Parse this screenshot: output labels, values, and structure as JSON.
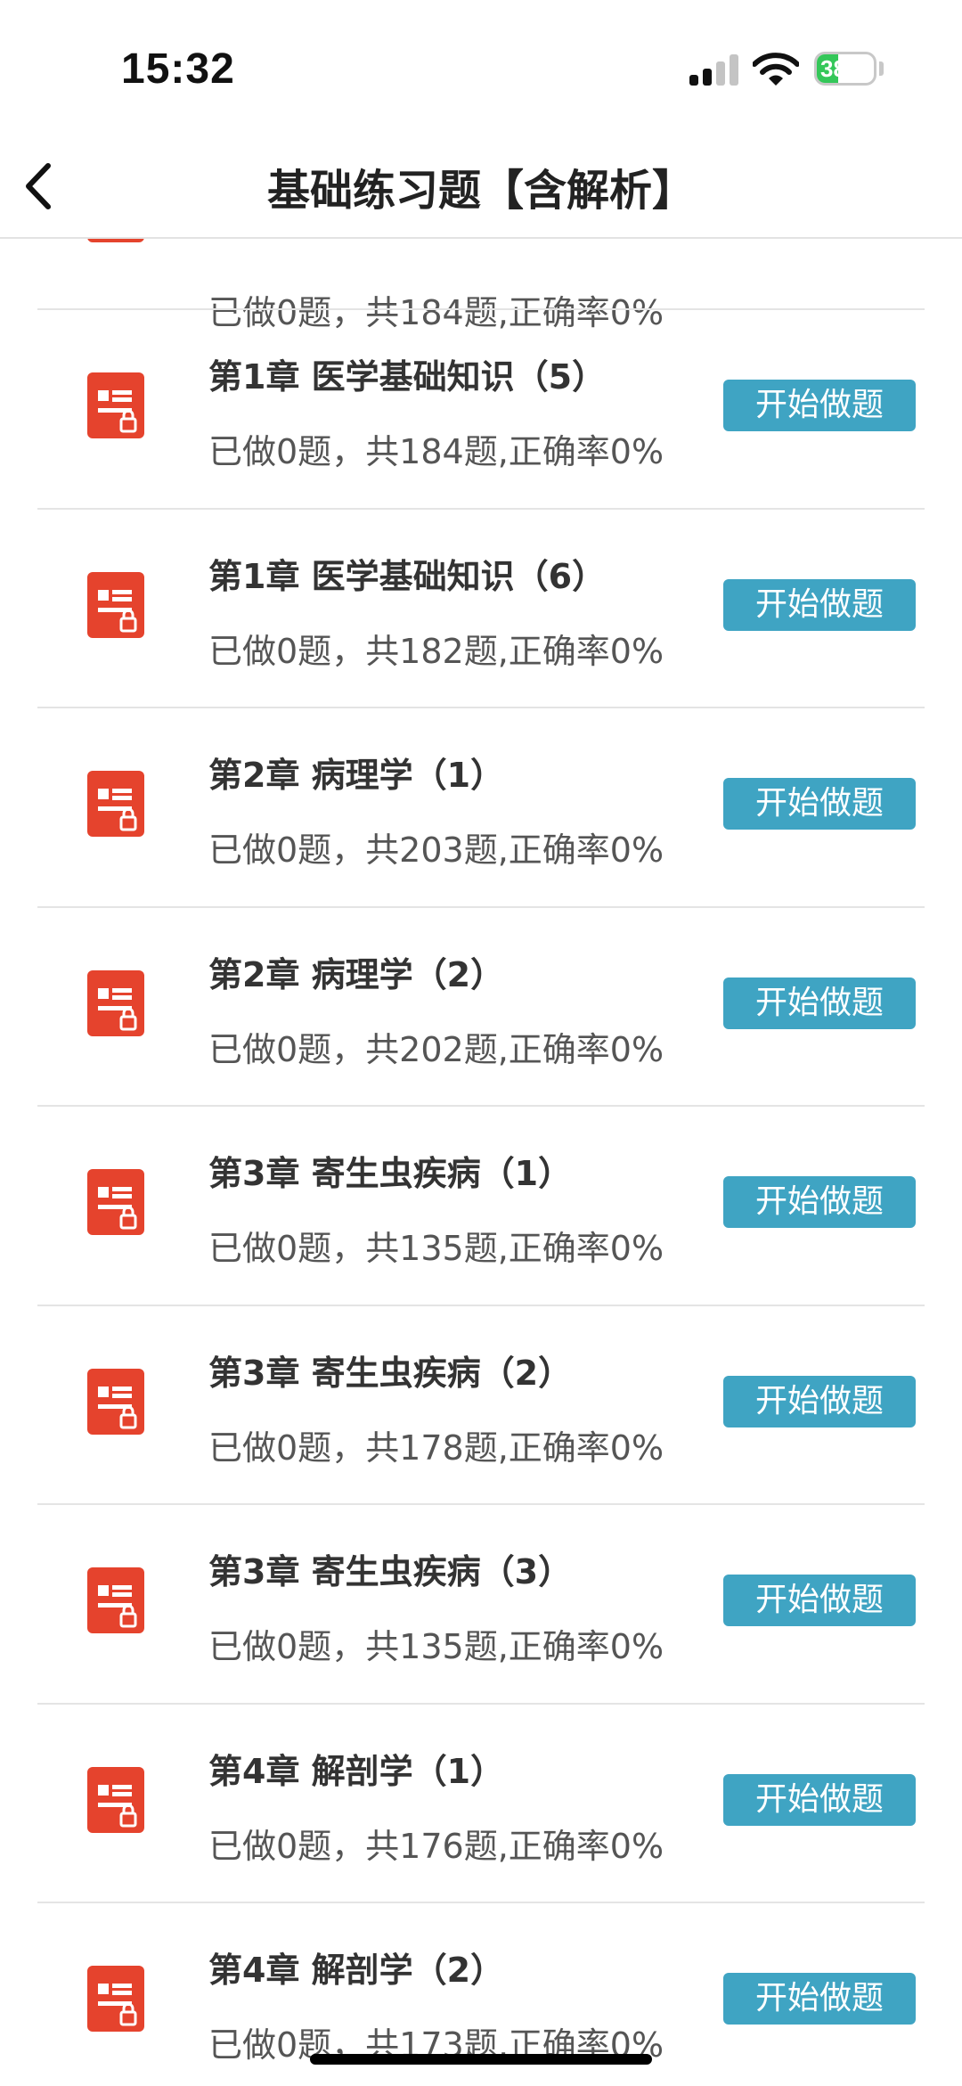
{
  "status_bar": {
    "time": "15:32",
    "battery": "38",
    "battery_level": 0.38,
    "battery_color": "#34c759"
  },
  "nav": {
    "title": "基础练习题【含解析】",
    "back_icon": "chevron-left-icon"
  },
  "colors": {
    "icon_red": "#e5432d",
    "button_blue": "#3fa4c3"
  },
  "partial_item": {
    "subtitle": "已做0题，共184题,正确率0%"
  },
  "items": [
    {
      "title": "第1章  医学基础知识（5）",
      "subtitle": "已做0题，共184题,正确率0%",
      "button": "开始做题"
    },
    {
      "title": "第1章  医学基础知识（6）",
      "subtitle": "已做0题，共182题,正确率0%",
      "button": "开始做题"
    },
    {
      "title": "第2章  病理学（1）",
      "subtitle": "已做0题，共203题,正确率0%",
      "button": "开始做题"
    },
    {
      "title": "第2章  病理学（2）",
      "subtitle": "已做0题，共202题,正确率0%",
      "button": "开始做题"
    },
    {
      "title": "第3章  寄生虫疾病（1）",
      "subtitle": "已做0题，共135题,正确率0%",
      "button": "开始做题"
    },
    {
      "title": "第3章  寄生虫疾病（2）",
      "subtitle": "已做0题，共178题,正确率0%",
      "button": "开始做题"
    },
    {
      "title": "第3章  寄生虫疾病（3）",
      "subtitle": "已做0题，共135题,正确率0%",
      "button": "开始做题"
    },
    {
      "title": "第4章  解剖学（1）",
      "subtitle": "已做0题，共176题,正确率0%",
      "button": "开始做题"
    },
    {
      "title": "第4章  解剖学（2）",
      "subtitle": "已做0题，共173题,正确率0%",
      "button": "开始做题"
    }
  ]
}
